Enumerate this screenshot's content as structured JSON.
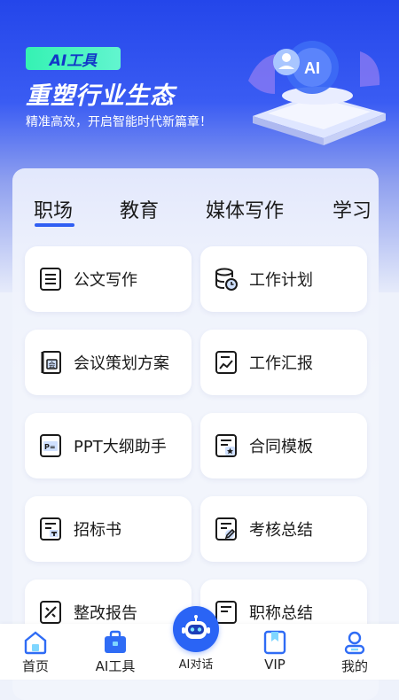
{
  "hero": {
    "badge": "AI工具",
    "title": "重塑行业生态",
    "subtitle": "精准高效，开启智能时代新篇章！",
    "art_text": "AI"
  },
  "tabs": [
    {
      "label": "职场",
      "active": true
    },
    {
      "label": "教育",
      "active": false
    },
    {
      "label": "媒体写作",
      "active": false
    },
    {
      "label": "学习",
      "active": false
    }
  ],
  "cards": [
    {
      "label": "公文写作",
      "icon": "document-list-icon"
    },
    {
      "label": "工作计划",
      "icon": "database-clock-icon"
    },
    {
      "label": "会议策划方案",
      "icon": "meeting-book-icon"
    },
    {
      "label": "工作汇报",
      "icon": "report-chart-icon"
    },
    {
      "label": "PPT大纲助手",
      "icon": "ppt-icon"
    },
    {
      "label": "合同模板",
      "icon": "contract-star-icon"
    },
    {
      "label": "招标书",
      "icon": "tender-doc-icon"
    },
    {
      "label": "考核总结",
      "icon": "edit-doc-icon"
    },
    {
      "label": "整改报告",
      "icon": "rectify-icon"
    },
    {
      "label": "职称总结",
      "icon": "title-doc-icon"
    }
  ],
  "nav": {
    "home": "首页",
    "ai_tools": "AI工具",
    "ai_chat": "AI对话",
    "vip": "VIP",
    "mine": "我的"
  },
  "colors": {
    "accent": "#2f5ef3",
    "badge": "#35f2b3",
    "hero_top": "#2446ea"
  }
}
